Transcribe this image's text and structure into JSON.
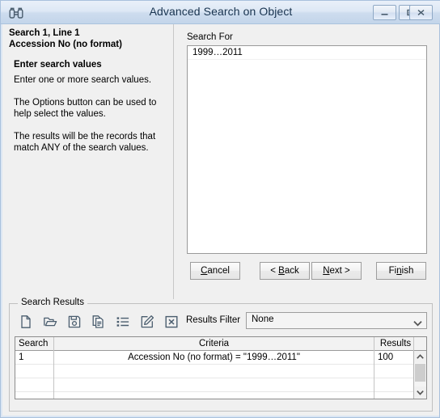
{
  "window": {
    "title": "Advanced Search on Object",
    "icon": "binoculars-icon",
    "controls": {
      "minimize": "minimize-icon",
      "maximize": "maximize-icon",
      "close": "close-icon"
    }
  },
  "instructions": {
    "heading_line1": "Search 1, Line 1",
    "heading_line2": "Accession No (no format)",
    "subheading": "Enter search values",
    "paragraph1": "Enter one or more search values.",
    "paragraph2": "The Options button can be used to help select the values.",
    "paragraph3": "The results will be the records that match ANY of the search values."
  },
  "search_for": {
    "label": "Search For",
    "values": [
      "1999…2011"
    ]
  },
  "wizard_buttons": {
    "cancel": {
      "pre": "",
      "mnemonic": "C",
      "post": "ancel"
    },
    "back": {
      "pre": "< ",
      "mnemonic": "B",
      "post": "ack"
    },
    "next": {
      "pre": "",
      "mnemonic": "N",
      "post": "ext >"
    },
    "finish": {
      "pre": "Fi",
      "mnemonic": "n",
      "post": "ish"
    }
  },
  "search_results": {
    "legend": "Search Results",
    "toolbar": [
      {
        "name": "new-icon",
        "label": "New"
      },
      {
        "name": "open-icon",
        "label": "Open"
      },
      {
        "name": "save-icon",
        "label": "Save"
      },
      {
        "name": "copy-icon",
        "label": "Copy"
      },
      {
        "name": "list-icon",
        "label": "List"
      },
      {
        "name": "edit-icon",
        "label": "Edit"
      },
      {
        "name": "delete-icon",
        "label": "Delete"
      }
    ],
    "filter": {
      "label": "Results Filter",
      "value": "None",
      "options": [
        "None"
      ]
    },
    "table": {
      "columns": [
        "Search",
        "Criteria",
        "Results"
      ],
      "rows": [
        {
          "search": "1",
          "criteria": "Accession No (no format) = \"1999…2011\"",
          "results": "100"
        }
      ]
    }
  },
  "colors": {
    "titlebar_top": "#e9f0f9",
    "titlebar_bottom": "#c3d5ea",
    "window_border": "#a9c1dd",
    "panel_bg": "#f0f0f0",
    "icon_stroke": "#4a5d6e",
    "field_bg": "#ffffff"
  }
}
